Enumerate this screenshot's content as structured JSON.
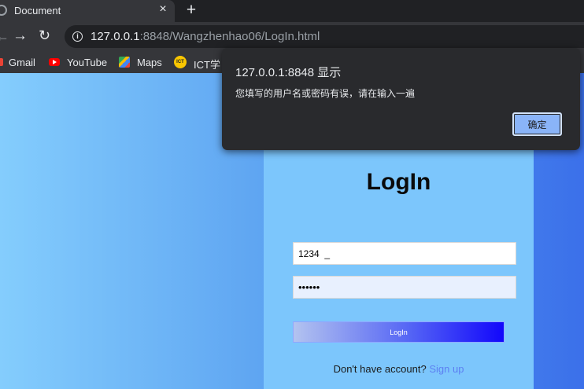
{
  "browser": {
    "tab_title": "Document",
    "tab_close_glyph": "×",
    "new_tab_glyph": "+",
    "url_host": "127.0.0.1",
    "url_rest": ":8848/Wangzhenhao06/LogIn.html",
    "info_glyph": "i"
  },
  "bookmarks": [
    {
      "label": "Gmail",
      "icon": "gmail-icon"
    },
    {
      "label": "YouTube",
      "icon": "youtube-icon"
    },
    {
      "label": "Maps",
      "icon": "maps-icon"
    },
    {
      "label": "ICT学",
      "icon": "ict-icon"
    }
  ],
  "bookmarks_ict_icon_text": "ICT",
  "login": {
    "title": "LogIn",
    "username_value": "1234  _",
    "password_value": "••••••",
    "button_label": "LogIn",
    "signup_prompt": "Don't have account?",
    "signup_link": "Sign up"
  },
  "alert": {
    "title": "127.0.0.1:8848 显示",
    "message": "您填写的用户名或密码有误，请在输入一遍",
    "ok_label": "确定"
  },
  "colors": {
    "accent": "#8ab4f8",
    "page_gradient_start": "#84cdfd",
    "page_gradient_end": "#3b70ea",
    "card": "#7cc6fc",
    "login_button_end": "#1207fb",
    "signup_link": "#5d80f2"
  }
}
